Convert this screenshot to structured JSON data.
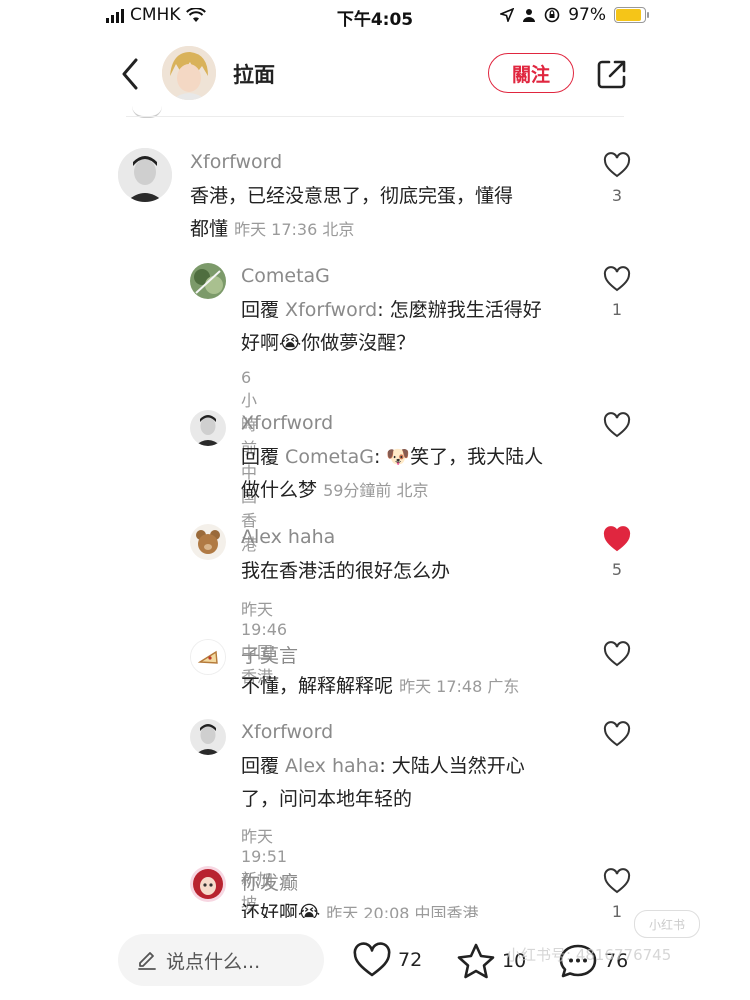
{
  "status_bar": {
    "carrier": "CMHK",
    "time": "下午4:05",
    "battery": "97%",
    "battery_level": 0.97
  },
  "header": {
    "title": "拉面",
    "follow_label": "關注"
  },
  "comments": [
    {
      "name": "Xforfword",
      "text_line1": "香港，已经没意思了，彻底完蛋，懂得",
      "text_line2": "都懂",
      "time": "昨天 17:36 北京",
      "likes": "3",
      "liked": false
    },
    {
      "name": "CometaG",
      "reply_prefix": "回覆 ",
      "reply_to": "Xforfword",
      "text_line1": ": 怎麼辦我生活得好",
      "text_line2a": "好啊",
      "emoji": "😭",
      "text_line2b": "你做夢沒醒？",
      "time": "6小時前 中国香港",
      "likes": "1",
      "liked": false
    },
    {
      "name": "Xforfword",
      "reply_prefix": "回覆 ",
      "reply_to": "CometaG",
      "text_sep": ": ",
      "emoji": "🐶",
      "text_line1": "笑了，我大陆人",
      "text_line2": "做什么梦",
      "time": "59分鐘前 北京",
      "likes": "",
      "liked": false
    },
    {
      "name": "Alex haha",
      "text_line1": "我在香港活的很好怎么办",
      "time": "昨天 19:46 中国香港",
      "likes": "5",
      "liked": true
    },
    {
      "name": "子莫言",
      "text_line1": "不懂，解释解释呢",
      "time": "昨天 17:48 广东",
      "likes": "",
      "liked": false
    },
    {
      "name": "Xforfword",
      "reply_prefix": "回覆 ",
      "reply_to": "Alex haha",
      "text_line1": ": 大陆人当然开心",
      "text_line2": "了，问问本地年轻的",
      "time": "昨天 19:51 新加坡",
      "likes": "",
      "liked": false
    },
    {
      "name": "你发癫",
      "text_line1": "还好啊",
      "emoji": "😭",
      "time": "昨天 20:08 中国香港",
      "likes": "1",
      "liked": false
    }
  ],
  "bottom_bar": {
    "input_placeholder": "说点什么...",
    "likes": "72",
    "stars": "10",
    "comments": "76"
  },
  "watermark": {
    "logo": "小红书",
    "text": "小红书号: 4816776745"
  },
  "colors": {
    "accent": "#e0263f",
    "secondary_text": "#8a8a8a",
    "battery": "#f5c518"
  }
}
